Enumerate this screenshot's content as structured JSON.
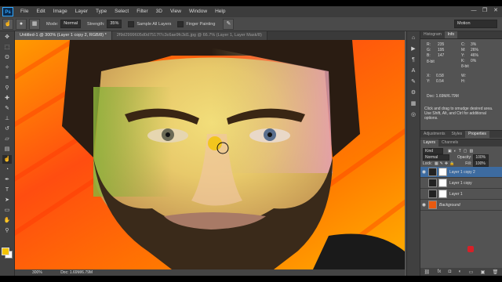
{
  "app": {
    "logo": "Ps"
  },
  "menu": [
    "File",
    "Edit",
    "Image",
    "Layer",
    "Type",
    "Select",
    "Filter",
    "3D",
    "View",
    "Window",
    "Help"
  ],
  "window_controls": [
    "—",
    "❐",
    "✕"
  ],
  "options": {
    "mode_label": "Mode:",
    "mode_value": "Normal",
    "strength_label": "Strength:",
    "strength_value": "35%",
    "sample_all_layers": "Sample All Layers",
    "finger_painting": "Finger Painting",
    "workspace": "Motion"
  },
  "tabs": [
    {
      "label": "Untitled-1 @ 300% (Layer 1 copy 2, RGB/8) *",
      "active": true
    },
    {
      "label": "2f9d2999605d0d7517f7c3c6ae9fc3d1.jpg @ 66.7% (Layer 1, Layer Mask/8)",
      "active": false
    }
  ],
  "status": {
    "zoom": "300%",
    "doc": "Doc: 1.69M/6.79M"
  },
  "info": {
    "tabs": [
      "Histogram",
      "Info"
    ],
    "rgb_labels": [
      "R:",
      "G:",
      "B:"
    ],
    "rgb_values": [
      "235",
      "195",
      "147"
    ],
    "bits_left": "8-bit",
    "cmyk_labels": [
      "C:",
      "M:",
      "Y:",
      "K:"
    ],
    "cmyk_values": [
      "3%",
      "26%",
      "46%",
      "0%"
    ],
    "bits_right": "8-bit",
    "x_label": "X:",
    "x_value": "0.58",
    "y_label": "Y:",
    "y_value": "0.54",
    "w_label": "W:",
    "h_label": "H:",
    "doc": "Doc: 1.69M/6.79M",
    "hint": "Click and drag to smudge desired area. Use Shift, Alt, and Ctrl for additional options."
  },
  "adjust_tabs": [
    "Adjustments",
    "Styles",
    "Properties"
  ],
  "layers_panel": {
    "tabs": [
      "Layers",
      "Channels"
    ],
    "kind": "Kind",
    "blend": "Normal",
    "opacity_label": "Opacity:",
    "opacity_value": "100%",
    "lock_label": "Lock:",
    "fill_label": "Fill:",
    "fill_value": "100%",
    "layers": [
      {
        "name": "Layer 1 copy 2",
        "selected": true,
        "italic": false
      },
      {
        "name": "Layer 1 copy",
        "selected": false,
        "italic": false
      },
      {
        "name": "Layer 1",
        "selected": false,
        "italic": false
      },
      {
        "name": "Background",
        "selected": false,
        "italic": true
      }
    ]
  }
}
